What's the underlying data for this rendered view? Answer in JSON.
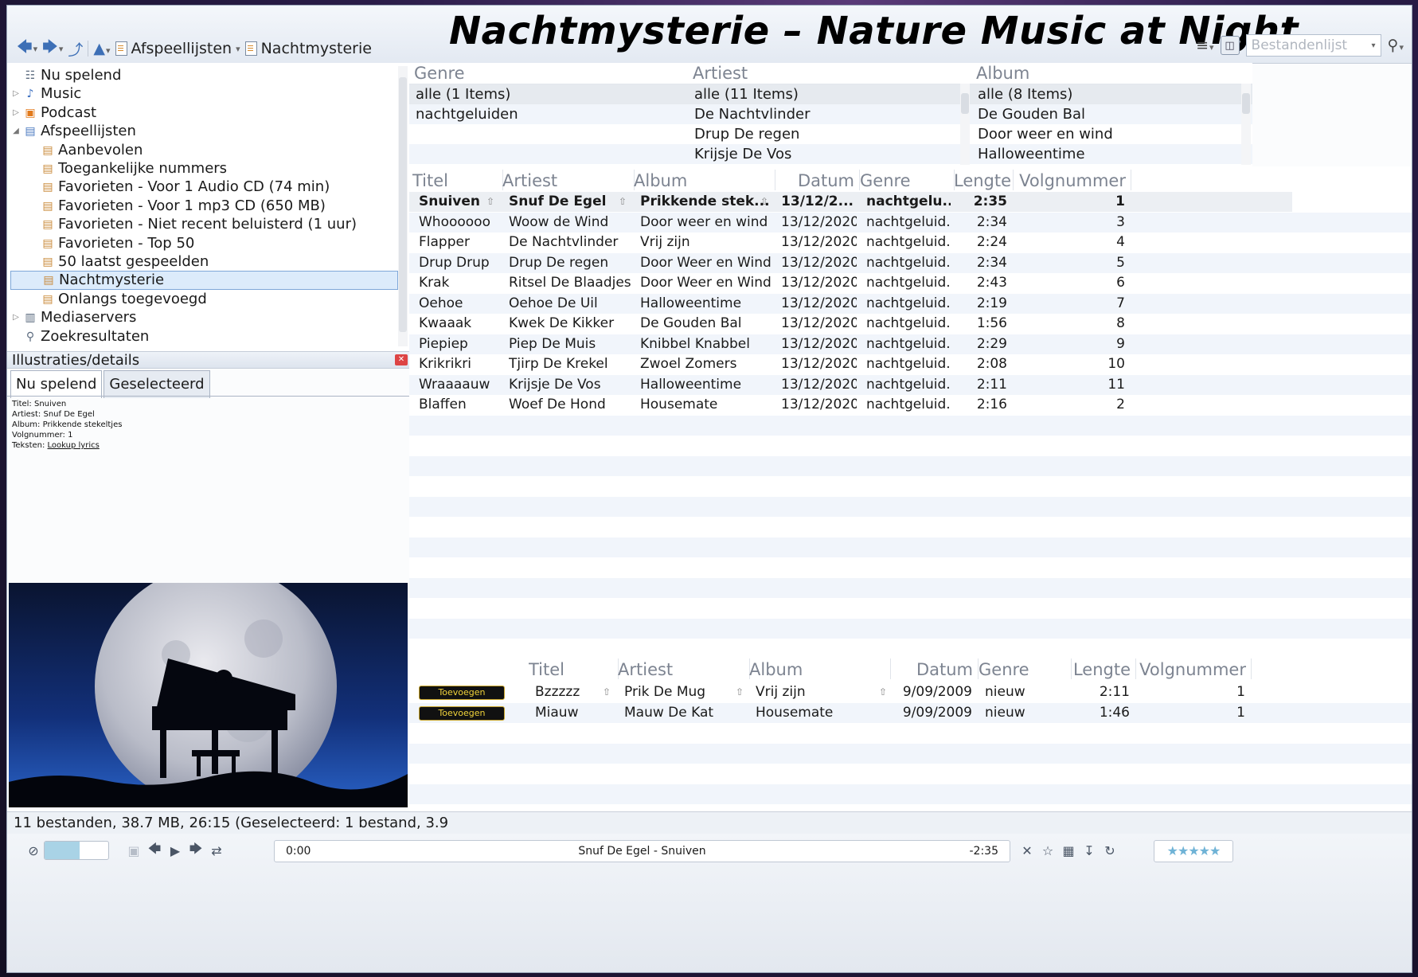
{
  "window_title": "Nachtmysterie – Nature Music at Night",
  "breadcrumb": [
    "Afspeellijsten",
    "Nachtmysterie"
  ],
  "search": {
    "placeholder": "Bestandenlijst"
  },
  "tree": [
    {
      "label": "Nu spelend",
      "icon": "now-playing-icon",
      "level": 0,
      "expander": ""
    },
    {
      "label": "Music",
      "icon": "music-note-icon",
      "level": 0,
      "expander": "▷"
    },
    {
      "label": "Podcast",
      "icon": "podcast-icon",
      "level": 0,
      "expander": "▷"
    },
    {
      "label": "Afspeellijsten",
      "icon": "playlists-icon",
      "level": 0,
      "expander": "◢"
    },
    {
      "label": "Aanbevolen",
      "icon": "playlist-icon",
      "level": 1,
      "expander": ""
    },
    {
      "label": "Toegankelijke nummers",
      "icon": "playlist-icon",
      "level": 1,
      "expander": ""
    },
    {
      "label": "Favorieten - Voor 1 Audio CD (74 min)",
      "icon": "playlist-icon",
      "level": 1,
      "expander": ""
    },
    {
      "label": "Favorieten - Voor 1 mp3 CD (650 MB)",
      "icon": "playlist-icon",
      "level": 1,
      "expander": ""
    },
    {
      "label": "Favorieten - Niet recent beluisterd (1 uur)",
      "icon": "playlist-icon",
      "level": 1,
      "expander": ""
    },
    {
      "label": "Favorieten - Top 50",
      "icon": "playlist-icon",
      "level": 1,
      "expander": ""
    },
    {
      "label": "50 laatst gespeelden",
      "icon": "playlist-icon",
      "level": 1,
      "expander": ""
    },
    {
      "label": "Nachtmysterie",
      "icon": "playlist-icon",
      "level": 1,
      "expander": "",
      "selected": true
    },
    {
      "label": "Onlangs toegevoegd",
      "icon": "playlist-icon",
      "level": 1,
      "expander": ""
    },
    {
      "label": "Mediaservers",
      "icon": "server-icon",
      "level": 0,
      "expander": "▷"
    },
    {
      "label": "Zoekresultaten",
      "icon": "search-results-icon",
      "level": 0,
      "expander": ""
    }
  ],
  "details": {
    "title": "Illustraties/details",
    "tabs": [
      "Nu spelend",
      "Geselecteerd"
    ],
    "info": {
      "titel": "Titel: Snuiven",
      "artiest": "Artiest: Snuf De Egel",
      "album": "Album: Prikkende stekeltjes",
      "volgnummer": "Volgnummer: 1",
      "teksten_label": "Teksten:",
      "teksten_link": "Lookup lyrics"
    }
  },
  "filters": {
    "genre": {
      "header": "Genre",
      "items": [
        "alle (1 Items)",
        "nachtgeluiden"
      ]
    },
    "artist": {
      "header": "Artiest",
      "items": [
        "alle (11 Items)",
        "De Nachtvlinder",
        "Drup De regen",
        "Krijsje De Vos"
      ]
    },
    "album": {
      "header": "Album",
      "items": [
        "alle (8 Items)",
        "De Gouden Bal",
        "Door weer en wind",
        "Halloweentime"
      ]
    }
  },
  "tracks": {
    "columns": [
      "Titel",
      "Artiest",
      "Album",
      "Datum",
      "Genre",
      "Lengte",
      "Volgnummer"
    ],
    "rows": [
      {
        "title": "Snuiven",
        "artist": "Snuf De Egel",
        "album": "Prikkende stek...",
        "date": "13/12/2...",
        "genre": "nachtgelu...",
        "length": "2:35",
        "track": "1",
        "playing": true
      },
      {
        "title": "Whoooooo",
        "artist": "Woow de Wind",
        "album": "Door weer en wind",
        "date": "13/12/2020",
        "genre": "nachtgeluid...",
        "length": "2:34",
        "track": "3"
      },
      {
        "title": "Flapper",
        "artist": "De Nachtvlinder",
        "album": "Vrij zijn",
        "date": "13/12/2020",
        "genre": "nachtgeluid...",
        "length": "2:24",
        "track": "4"
      },
      {
        "title": "Drup Drup",
        "artist": "Drup De regen",
        "album": "Door Weer en Wind",
        "date": "13/12/2020",
        "genre": "nachtgeluid...",
        "length": "2:34",
        "track": "5"
      },
      {
        "title": "Krak",
        "artist": "Ritsel De Blaadjes",
        "album": "Door Weer en Wind",
        "date": "13/12/2020",
        "genre": "nachtgeluid...",
        "length": "2:43",
        "track": "6"
      },
      {
        "title": "Oehoe",
        "artist": "Oehoe De Uil",
        "album": "Halloweentime",
        "date": "13/12/2020",
        "genre": "nachtgeluid...",
        "length": "2:19",
        "track": "7"
      },
      {
        "title": "Kwaaak",
        "artist": "Kwek De Kikker",
        "album": "De Gouden Bal",
        "date": "13/12/2020",
        "genre": "nachtgeluid...",
        "length": "1:56",
        "track": "8"
      },
      {
        "title": "Piepiep",
        "artist": "Piep De Muis",
        "album": "Knibbel Knabbel",
        "date": "13/12/2020",
        "genre": "nachtgeluid...",
        "length": "2:29",
        "track": "9"
      },
      {
        "title": "Krikrikri",
        "artist": "Tjirp De Krekel",
        "album": "Zwoel Zomers",
        "date": "13/12/2020",
        "genre": "nachtgeluid...",
        "length": "2:08",
        "track": "10"
      },
      {
        "title": "Wraaaauw",
        "artist": "Krijsje De Vos",
        "album": "Halloweentime",
        "date": "13/12/2020",
        "genre": "nachtgeluid...",
        "length": "2:11",
        "track": "11"
      },
      {
        "title": "Blaffen",
        "artist": "Woef De Hond",
        "album": "Housemate",
        "date": "13/12/2020",
        "genre": "nachtgeluid...",
        "length": "2:16",
        "track": "2"
      }
    ]
  },
  "suggestions": {
    "columns": [
      "Titel",
      "Artiest",
      "Album",
      "Datum",
      "Genre",
      "Lengte",
      "Volgnummer"
    ],
    "add_label": "Toevoegen",
    "rows": [
      {
        "title": "Bzzzzz",
        "artist": "Prik De Mug",
        "album": "Vrij zijn",
        "date": "9/09/2009",
        "genre": "nieuw",
        "length": "2:11",
        "track": "1"
      },
      {
        "title": "Miauw",
        "artist": "Mauw De Kat",
        "album": "Housemate",
        "date": "9/09/2009",
        "genre": "nieuw",
        "length": "1:46",
        "track": "1"
      }
    ]
  },
  "status_text": "11 bestanden, 38.7 MB, 26:15 (Geselecteerd: 1 bestand, 3.9",
  "player": {
    "elapsed": "0:00",
    "now_playing": "Snuf De Egel - Snuiven",
    "remaining": "-2:35",
    "rating_stars": "★★★★★",
    "volume_fraction": 0.55
  },
  "colors": {
    "selection": "#dcebfb",
    "stripe": "#f1f5fb",
    "add_button_text": "#f0d23a",
    "star": "#6fb3d6"
  }
}
